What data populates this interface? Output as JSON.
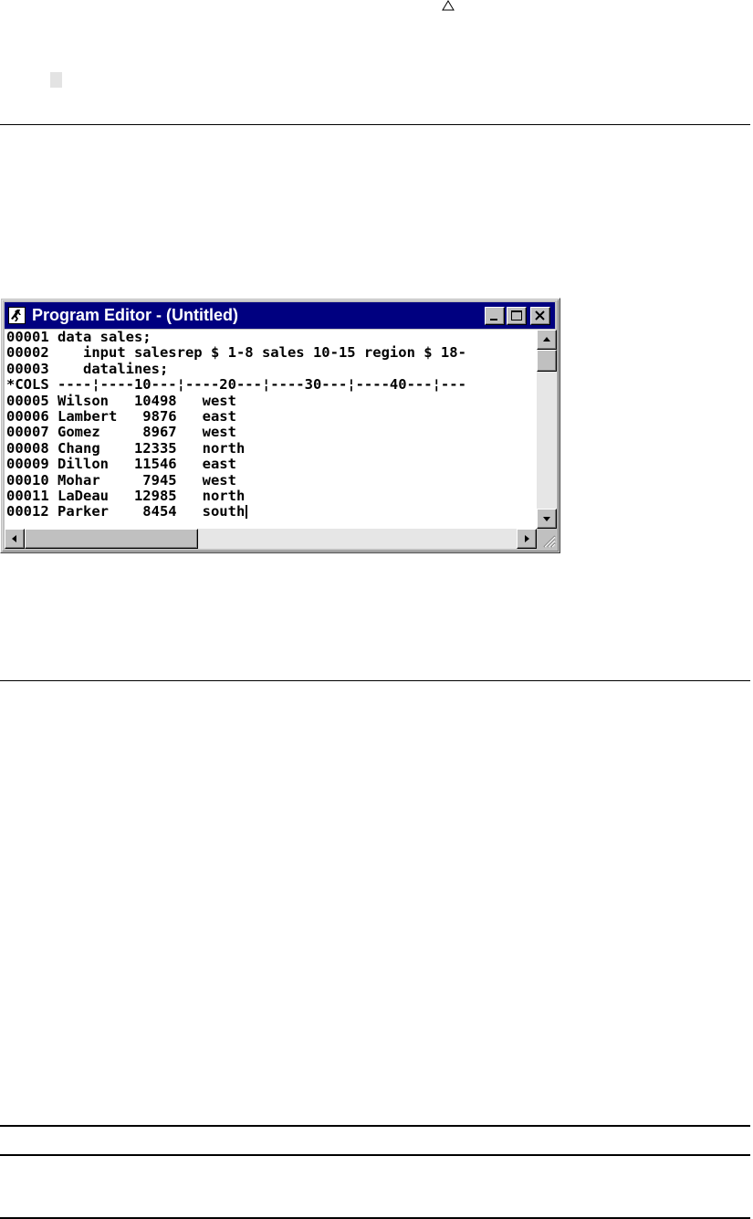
{
  "page": {
    "triangle_icon": "triangle-outline-icon"
  },
  "window": {
    "title": "Program Editor - (Untitled)",
    "icon": "sas-runner-icon",
    "controls": {
      "minimize_icon": "minimize-icon",
      "maximize_icon": "maximize-icon",
      "close_icon": "close-icon"
    }
  },
  "editor": {
    "lines": [
      "00001 data sales;",
      "00002    input salesrep $ 1-8 sales 10-15 region $ 18-",
      "00003    datalines;",
      "*COLS ----¦----10---¦----20---¦----30---¦----40---¦---",
      "00005 Wilson   10498   west",
      "00006 Lambert   9876   east",
      "00007 Gomez     8967   west",
      "00008 Chang    12335   north",
      "00009 Dillon   11546   east",
      "00010 Mohar     7945   west",
      "00011 LaDeau   12985   north",
      "00012 Parker    8454   south"
    ]
  },
  "scrollbars": {
    "up_icon": "arrow-up-icon",
    "down_icon": "arrow-down-icon",
    "left_icon": "arrow-left-icon",
    "right_icon": "arrow-right-icon",
    "grip_icon": "size-grip-icon"
  }
}
